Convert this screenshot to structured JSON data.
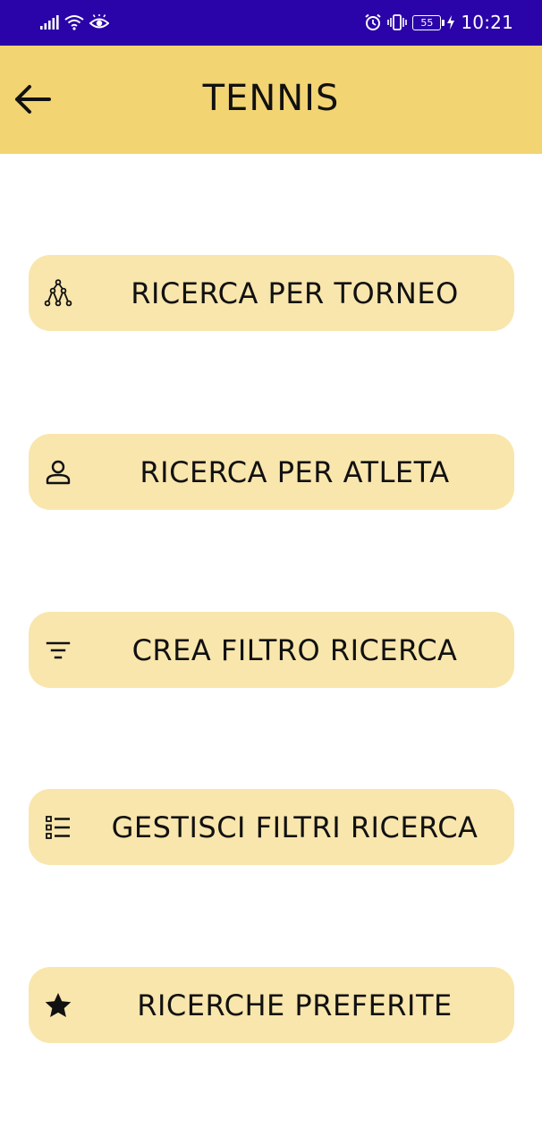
{
  "status_bar": {
    "battery": "55",
    "time": "10:21"
  },
  "app_bar": {
    "title": "TENNIS",
    "back_icon": "arrow-left-icon"
  },
  "menu": {
    "items": [
      {
        "label": "RICERCA PER TORNEO",
        "icon": "tournament-bracket-icon"
      },
      {
        "label": "RICERCA PER ATLETA",
        "icon": "person-icon"
      },
      {
        "label": "CREA FILTRO RICERCA",
        "icon": "filter-icon"
      },
      {
        "label": "GESTISCI FILTRI RICERCA",
        "icon": "list-icon"
      },
      {
        "label": "RICERCHE PREFERITE",
        "icon": "star-icon"
      }
    ]
  },
  "colors": {
    "status_bar": "#2a04a8",
    "app_bar": "#f2d473",
    "button_bg": "#f9e6ad",
    "text": "#111111"
  }
}
